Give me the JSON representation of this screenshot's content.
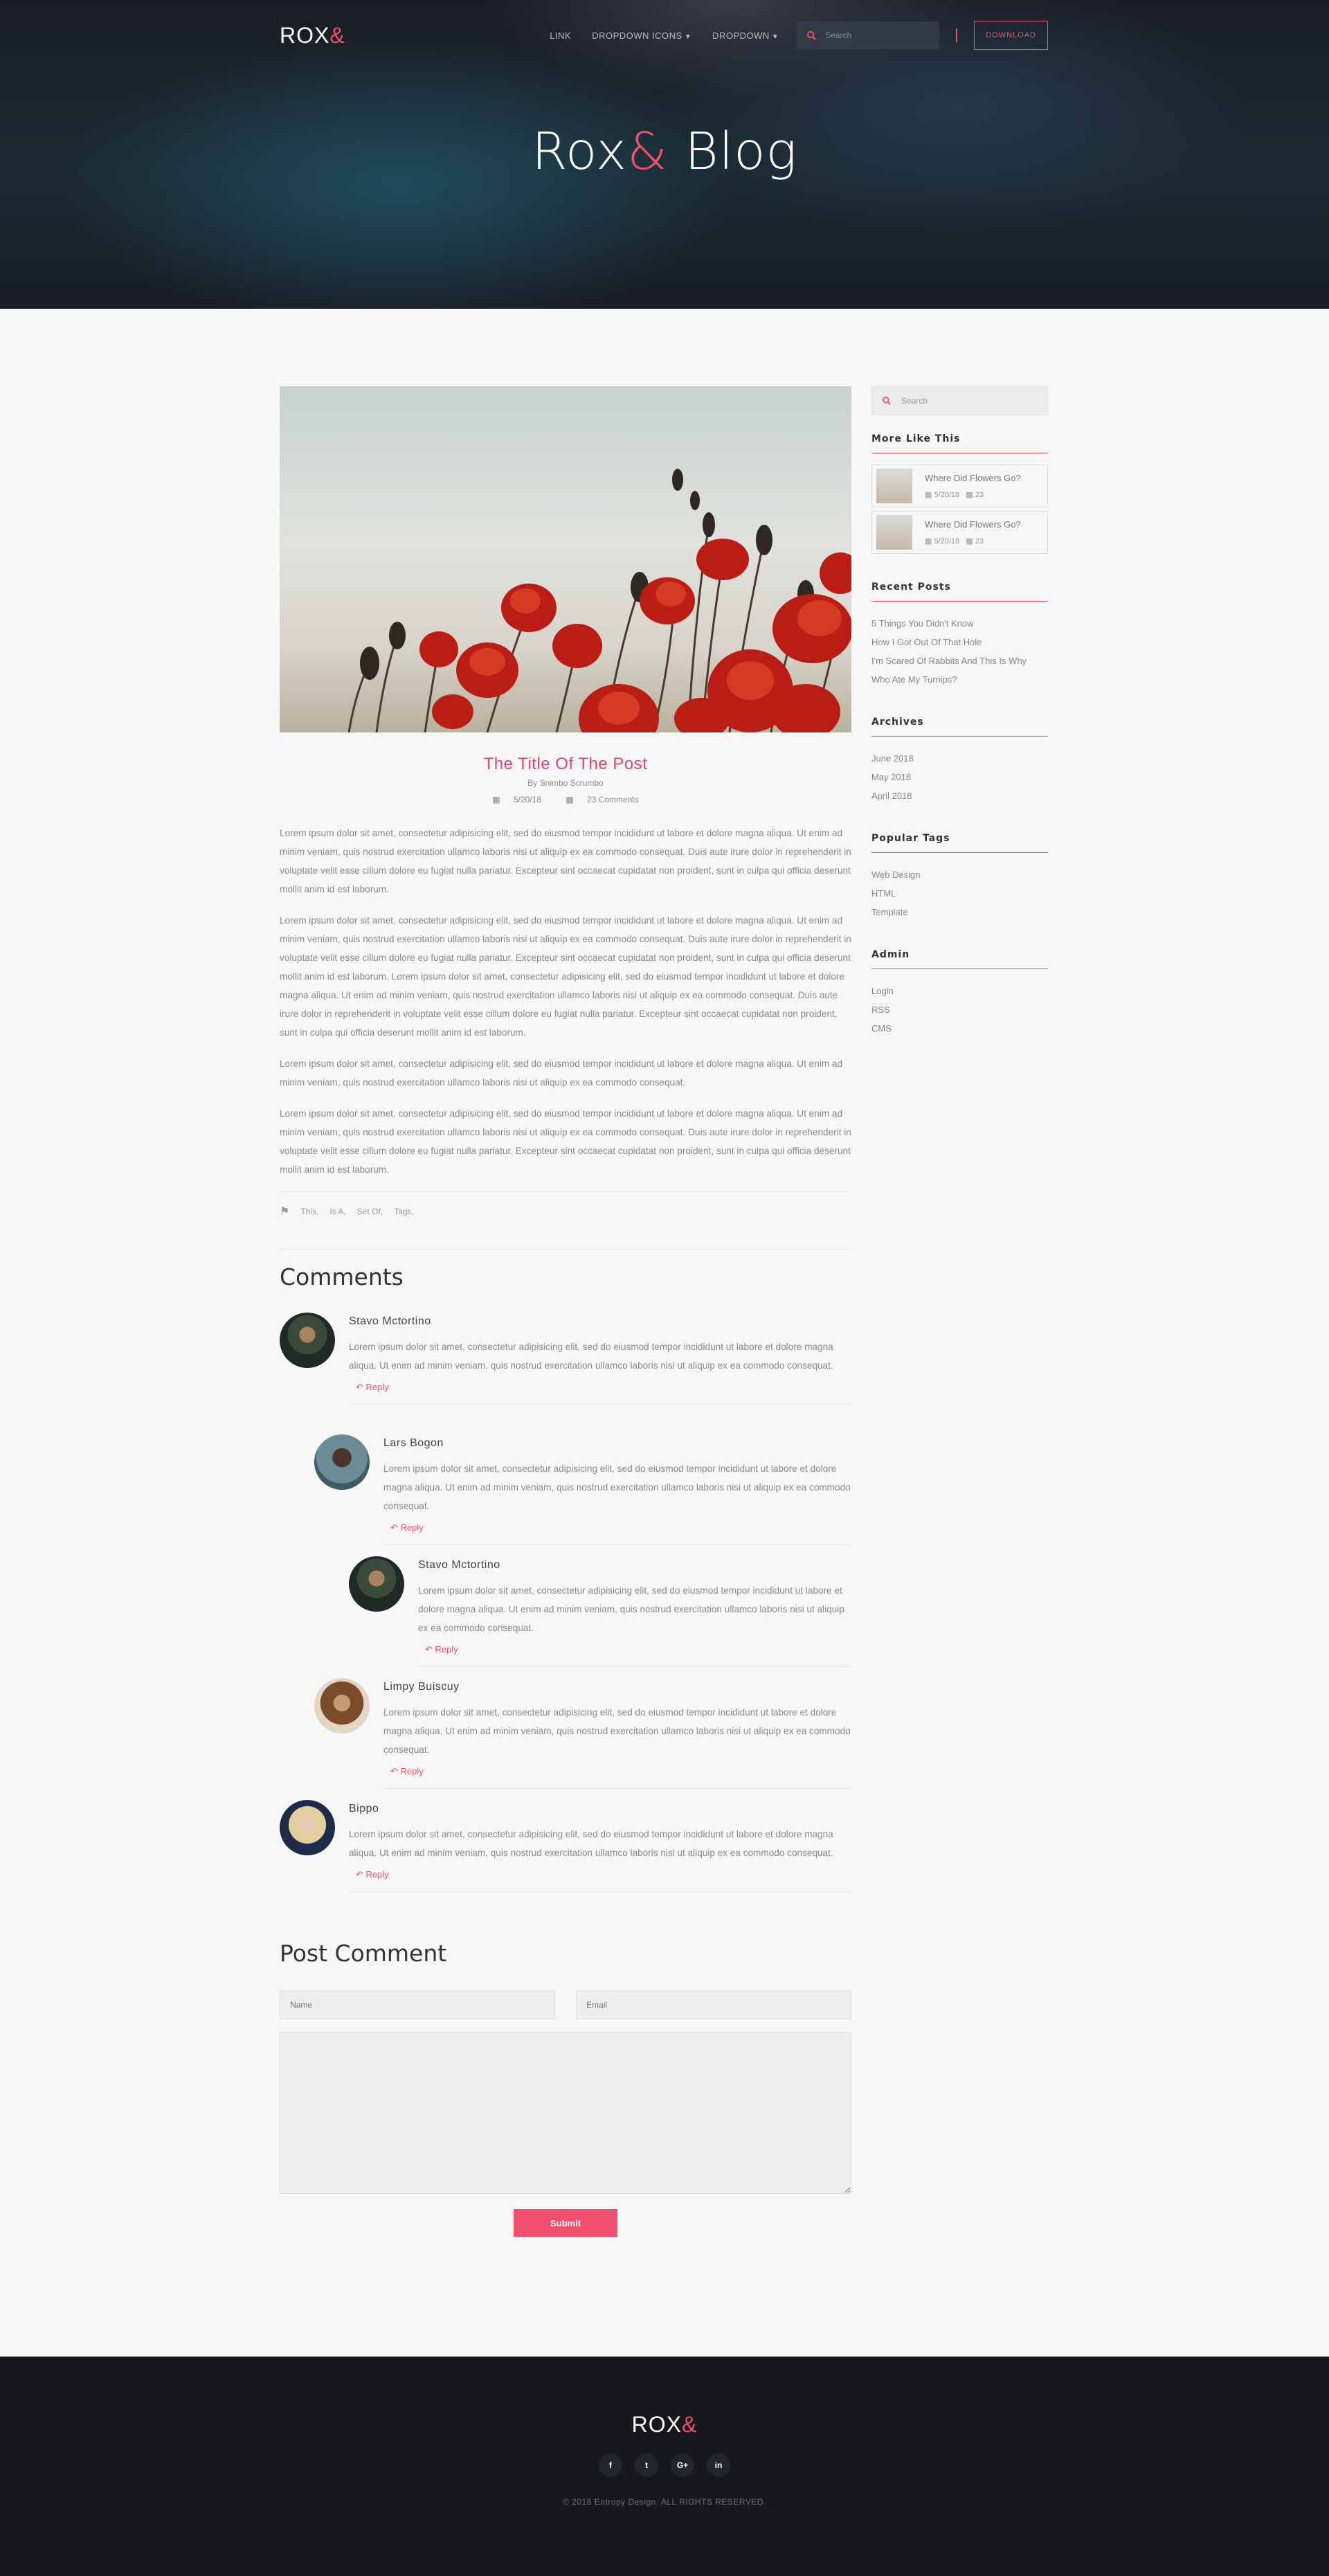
{
  "header": {
    "logo_text": "ROX",
    "logo_amp": "&",
    "nav": [
      "LINK",
      "DROPDOWN ICONS",
      "DROPDOWN"
    ],
    "search_placeholder": "Search",
    "download_label": "DOWNLOAD",
    "hero_title": "Rox",
    "hero_amp": "&",
    "hero_suffix": " Blog"
  },
  "post": {
    "title": "The Title Of The Post",
    "author": "By Snimbo Scrumbo",
    "date": "5/20/18",
    "comments_count": "23 Comments",
    "paragraphs": [
      "Lorem ipsum dolor sit amet, consectetur adipisicing elit, sed do eiusmod tempor incididunt ut labore et dolore magna aliqua. Ut enim ad minim veniam, quis nostrud exercitation ullamco laboris nisi ut aliquip ex ea commodo consequat. Duis aute irure dolor in reprehenderit in voluptate velit esse cillum dolore eu fugiat nulla pariatur. Excepteur sint occaecat cupidatat non proident, sunt in culpa qui officia deserunt mollit anim id est laborum.",
      "Lorem ipsum dolor sit amet, consectetur adipisicing elit, sed do eiusmod tempor incididunt ut labore et dolore magna aliqua. Ut enim ad minim veniam, quis nostrud exercitation ullamco laboris nisi ut aliquip ex ea commodo consequat. Duis aute irure dolor in reprehenderit in voluptate velit esse cillum dolore eu fugiat nulla pariatur. Excepteur sint occaecat cupidatat non proident, sunt in culpa qui officia deserunt mollit anim id est laborum. Lorem ipsum dolor sit amet, consectetur adipisicing elit, sed do eiusmod tempor incididunt ut labore et dolore magna aliqua. Ut enim ad minim veniam, quis nostrud exercitation ullamco laboris nisi ut aliquip ex ea commodo consequat. Duis aute irure dolor in reprehenderit in voluptate velit esse cillum dolore eu fugiat nulla pariatur. Excepteur sint occaecat cupidatat non proident, sunt in culpa qui officia deserunt mollit anim id est laborum.",
      "Lorem ipsum dolor sit amet, consectetur adipisicing elit, sed do eiusmod tempor incididunt ut labore et dolore magna aliqua. Ut enim ad minim veniam, quis nostrud exercitation ullamco laboris nisi ut aliquip ex ea commodo consequat.",
      "Lorem ipsum dolor sit amet, consectetur adipisicing elit, sed do eiusmod tempor incididunt ut labore et dolore magna aliqua. Ut enim ad minim veniam, quis nostrud exercitation ullamco laboris nisi ut aliquip ex ea commodo consequat. Duis aute irure dolor in reprehenderit in voluptate velit esse cillum dolore eu fugiat nulla pariatur. Excepteur sint occaecat cupidatat non proident, sunt in culpa qui officia deserunt mollit anim id est laborum."
    ],
    "tags": [
      "This,",
      "Is A,",
      "Set Of,",
      "Tags,"
    ]
  },
  "comments": {
    "heading": "Comments",
    "reply_label": "Reply",
    "items": [
      {
        "name": "Stavo Mctortino",
        "text": "Lorem ipsum dolor sit amet, consectetur adipisicing elit, sed do eiusmod tempor incididunt ut labore et dolore magna aliqua. Ut enim ad minim veniam, quis nostrud exercitation ullamco laboris nisi ut aliquip ex ea commodo consequat."
      },
      {
        "name": "Lars Bogon",
        "text": "Lorem ipsum dolor sit amet, consectetur adipisicing elit, sed do eiusmod tempor incididunt ut labore et dolore magna aliqua. Ut enim ad minim veniam, quis nostrud exercitation ullamco laboris nisi ut aliquip ex ea commodo consequat."
      },
      {
        "name": "Stavo Mctortino",
        "text": "Lorem ipsum dolor sit amet, consectetur adipisicing elit, sed do eiusmod tempor incididunt ut labore et dolore magna aliqua. Ut enim ad minim veniam, quis nostrud exercitation ullamco laboris nisi ut aliquip ex ea commodo consequat."
      },
      {
        "name": "Limpy Buiscuy",
        "text": "Lorem ipsum dolor sit amet, consectetur adipisicing elit, sed do eiusmod tempor incididunt ut labore et dolore magna aliqua. Ut enim ad minim veniam, quis nostrud exercitation ullamco laboris nisi ut aliquip ex ea commodo consequat."
      },
      {
        "name": "Bippo",
        "text": "Lorem ipsum dolor sit amet, consectetur adipisicing elit, sed do eiusmod tempor incididunt ut labore et dolore magna aliqua. Ut enim ad minim veniam, quis nostrud exercitation ullamco laboris nisi ut aliquip ex ea commodo consequat."
      }
    ]
  },
  "form": {
    "heading": "Post Comment",
    "name_placeholder": "Name",
    "email_placeholder": "Email",
    "submit_label": "Submit"
  },
  "sidebar": {
    "search_placeholder": "Search",
    "more_heading": "More Like This",
    "more_items": [
      {
        "title": "Where Did Flowers Go?",
        "date": "5/20/18",
        "count": "23"
      },
      {
        "title": "Where Did Flowers Go?",
        "date": "5/20/18",
        "count": "23"
      }
    ],
    "recent_heading": "Recent Posts",
    "recent": [
      "5 Things You Didn't Know",
      "How I Got Out Of That Hole",
      "I'm Scared Of Rabbits And This Is Why",
      "Who Ate My Turnips?"
    ],
    "archives_heading": "Archives",
    "archives": [
      "June 2018",
      "May 2018",
      "April 2018"
    ],
    "tags_heading": "Popular Tags",
    "tags": [
      "Web Design",
      "HTML",
      "Template"
    ],
    "admin_heading": "Admin",
    "admin": [
      "Login",
      "RSS",
      "CMS"
    ]
  },
  "footer": {
    "logo_text": "ROX",
    "logo_amp": "&",
    "social": [
      "f",
      "t",
      "G+",
      "in"
    ],
    "copyright": "© 2018 Entropy Design. ALL RIGHTS RESERVED."
  },
  "colors": {
    "accent": "#f0506e",
    "dark": "#17181d",
    "background": "#f7f7f7"
  }
}
